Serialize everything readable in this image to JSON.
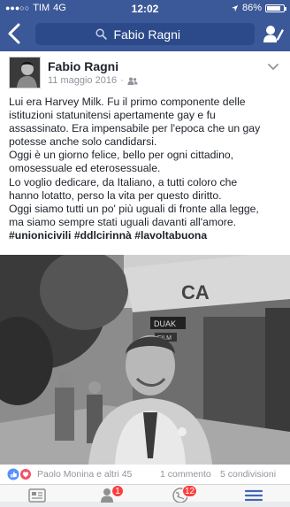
{
  "status_bar": {
    "carrier": "TIM",
    "network": "4G",
    "time": "12:02",
    "battery": "86%",
    "battery_level": 0.86
  },
  "nav": {
    "search_value": "Fabio Ragni"
  },
  "post": {
    "author": "Fabio Ragni",
    "date": "11 maggio 2016",
    "lines": [
      "Lui era Harvey Milk. Fu il primo componente delle",
      "istituzioni statunitensi apertamente gay e fu",
      "assassinato. Era impensabile per l'epoca che un gay",
      "potesse anche solo candidarsi.",
      "Oggi è un giorno felice, bello per ogni cittadino,",
      "omosessuale ed eterosessuale.",
      "Lo voglio dedicare, da Italiano, a tutti coloro che",
      "hanno lotatto, perso la vita per questo diritto.",
      "Oggi siamo tutti un po' più uguali di fronte alla legge,",
      "ma siamo sempre stati uguali davanti all'amore."
    ],
    "hashtags": "#unionicivili #ddlcirinnà #lavoltabuona",
    "photo_sign": "CA",
    "photo_sign2": "DUAK",
    "photo_sign3": "FILM"
  },
  "reactions": {
    "names": "Paolo Monina e altri 45",
    "comments": "1 commento",
    "shares": "5 condivisioni"
  },
  "tabbar": {
    "friend_badge": "1",
    "notif_badge": "12"
  },
  "colors": {
    "brand": "#3b5998",
    "badge": "#fa3e3e",
    "active_tab": "#4267b2"
  }
}
